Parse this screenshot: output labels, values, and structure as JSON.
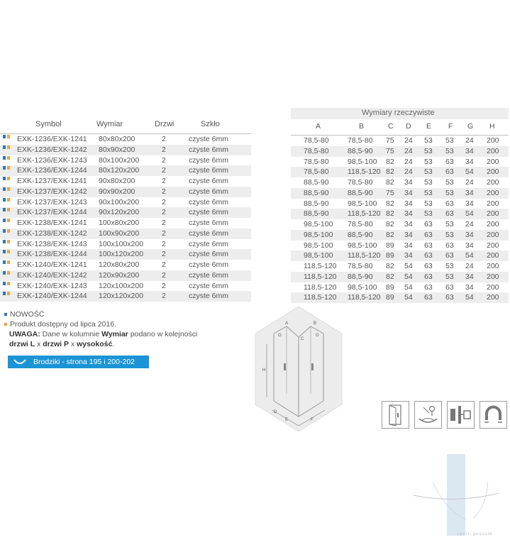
{
  "left_table": {
    "headers": {
      "symbol": "Symbol",
      "wymiar": "Wymiar",
      "drzwi": "Drzwi",
      "szklo": "Szkło"
    },
    "rows": [
      {
        "symbol": "EXK-1236/EXK-1241",
        "wymiar": "80x80x200",
        "drzwi": "2",
        "szklo": "czyste 6mm"
      },
      {
        "symbol": "EXK-1236/EXK-1242",
        "wymiar": "80x90x200",
        "drzwi": "2",
        "szklo": "czyste 6mm"
      },
      {
        "symbol": "EXK-1236/EXK-1243",
        "wymiar": "80x100x200",
        "drzwi": "2",
        "szklo": "czyste 6mm"
      },
      {
        "symbol": "EXK-1236/EXK-1244",
        "wymiar": "80x120x200",
        "drzwi": "2",
        "szklo": "czyste 6mm"
      },
      {
        "symbol": "EXK-1237/EXK-1241",
        "wymiar": "90x80x200",
        "drzwi": "2",
        "szklo": "czyste 6mm"
      },
      {
        "symbol": "EXK-1237/EXK-1242",
        "wymiar": "90x90x200",
        "drzwi": "2",
        "szklo": "czyste 6mm"
      },
      {
        "symbol": "EXK-1237/EXK-1243",
        "wymiar": "90x100x200",
        "drzwi": "2",
        "szklo": "czyste 6mm"
      },
      {
        "symbol": "EXK-1237/EXK-1244",
        "wymiar": "90x120x200",
        "drzwi": "2",
        "szklo": "czyste 6mm"
      },
      {
        "symbol": "EXK-1238/EXK-1241",
        "wymiar": "100x80x200",
        "drzwi": "2",
        "szklo": "czyste 6mm"
      },
      {
        "symbol": "EXK-1238/EXK-1242",
        "wymiar": "100x90x200",
        "drzwi": "2",
        "szklo": "czyste 6mm"
      },
      {
        "symbol": "EXK-1238/EXK-1243",
        "wymiar": "100x100x200",
        "drzwi": "2",
        "szklo": "czyste 6mm"
      },
      {
        "symbol": "EXK-1238/EXK-1244",
        "wymiar": "100x120x200",
        "drzwi": "2",
        "szklo": "czyste 6mm"
      },
      {
        "symbol": "EXK-1240/EXK-1241",
        "wymiar": "120x80x200",
        "drzwi": "2",
        "szklo": "czyste 6mm"
      },
      {
        "symbol": "EXK-1240/EXK-1242",
        "wymiar": "120x90x200",
        "drzwi": "2",
        "szklo": "czyste 6mm"
      },
      {
        "symbol": "EXK-1240/EXK-1243",
        "wymiar": "120x100x200",
        "drzwi": "2",
        "szklo": "czyste 6mm"
      },
      {
        "symbol": "EXK-1240/EXK-1244",
        "wymiar": "120x120x200",
        "drzwi": "2",
        "szklo": "czyste 6mm"
      }
    ]
  },
  "right_table": {
    "title": "Wymiary rzeczywiste",
    "headers": [
      "A",
      "B",
      "C",
      "D",
      "E",
      "F",
      "G",
      "H"
    ],
    "rows": [
      [
        "78,5-80",
        "78,5-80",
        "75",
        "24",
        "53",
        "53",
        "24",
        "200"
      ],
      [
        "78,5-80",
        "88,5-90",
        "75",
        "24",
        "53",
        "53",
        "34",
        "200"
      ],
      [
        "78,5-80",
        "98,5-100",
        "82",
        "24",
        "53",
        "63",
        "34",
        "200"
      ],
      [
        "78,5-80",
        "118,5-120",
        "82",
        "24",
        "53",
        "63",
        "54",
        "200"
      ],
      [
        "88,5-90",
        "78,5-80",
        "82",
        "34",
        "53",
        "53",
        "24",
        "200"
      ],
      [
        "88,5-90",
        "88,5-90",
        "75",
        "34",
        "53",
        "53",
        "34",
        "200"
      ],
      [
        "88,5-90",
        "98,5-100",
        "82",
        "34",
        "53",
        "63",
        "34",
        "200"
      ],
      [
        "88,5-90",
        "118,5-120",
        "82",
        "34",
        "53",
        "63",
        "54",
        "200"
      ],
      [
        "98,5-100",
        "78,5-80",
        "82",
        "34",
        "63",
        "53",
        "24",
        "200"
      ],
      [
        "98,5-100",
        "88,5-90",
        "82",
        "34",
        "63",
        "53",
        "34",
        "200"
      ],
      [
        "98,5-100",
        "98,5-100",
        "89",
        "34",
        "63",
        "63",
        "34",
        "200"
      ],
      [
        "98,5-100",
        "118,5-120",
        "89",
        "34",
        "63",
        "63",
        "54",
        "200"
      ],
      [
        "118,5-120",
        "78,5-80",
        "82",
        "54",
        "63",
        "53",
        "24",
        "200"
      ],
      [
        "118,5-120",
        "88,5-90",
        "82",
        "54",
        "63",
        "53",
        "34",
        "200"
      ],
      [
        "118,5-120",
        "98,5-100",
        "89",
        "54",
        "63",
        "63",
        "34",
        "200"
      ],
      [
        "118,5-120",
        "118,5-120",
        "89",
        "54",
        "63",
        "63",
        "54",
        "200"
      ]
    ]
  },
  "notes": {
    "new_label": "NOWOŚĆ",
    "available_label": "Produkt dostępny od lipca 2016.",
    "uwaga_label": "UWAGA:",
    "uwaga_text_1": " Dane w kolumnie ",
    "uwaga_bold_1": "Wymiar",
    "uwaga_text_2": " podano w kolejności",
    "drzwi_l": "drzwi L",
    "x1": " x ",
    "drzwi_p": "drzwi P",
    "x2": " x ",
    "wysokosc": "wysokość",
    "period": "."
  },
  "badge": {
    "label": "Brodziki - strona 195 i 200-202"
  },
  "diagram_labels": {
    "A": "A",
    "B": "B",
    "C": "C",
    "D": "D",
    "E": "E",
    "F": "F",
    "G": "G",
    "H": "H"
  },
  "logo": {
    "text": "venru pessule"
  },
  "colors": {
    "blue": "#2a78c2",
    "orange": "#f3a33b",
    "badge": "#1b94d6",
    "stripe": "#ededed"
  },
  "icons": [
    "door-hinge-icon",
    "easy-clean-icon",
    "profile-icon",
    "magnet-icon"
  ]
}
